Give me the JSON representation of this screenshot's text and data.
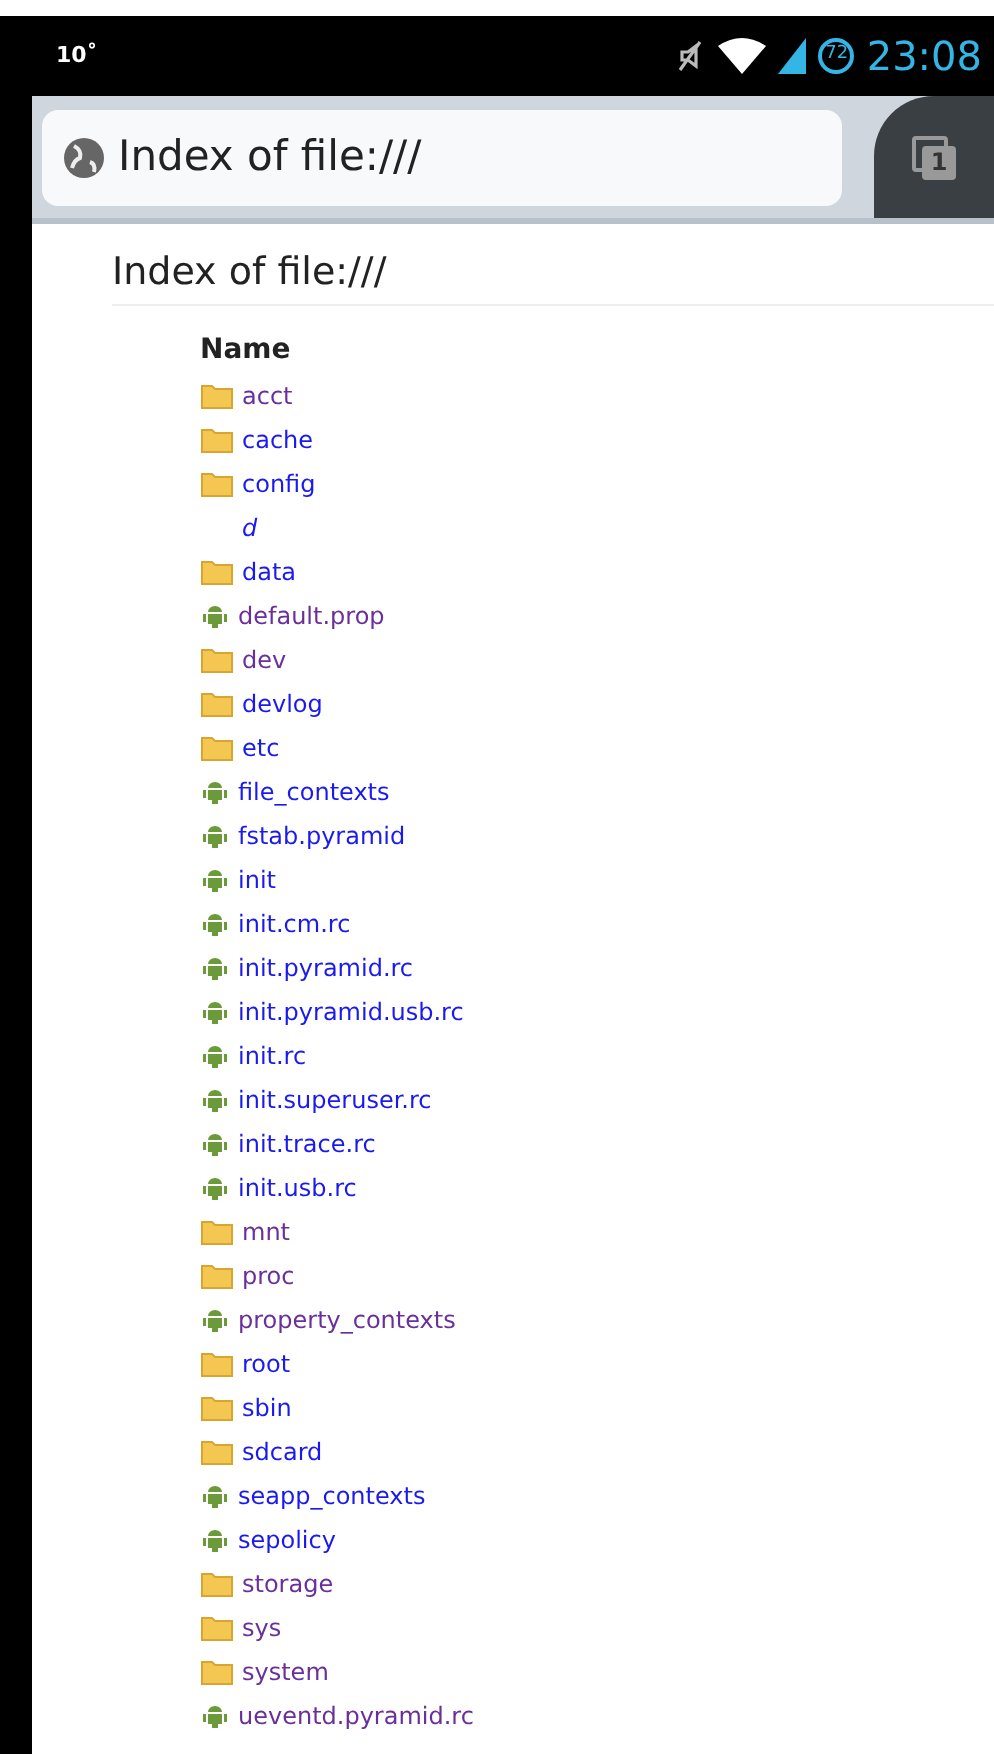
{
  "status_bar": {
    "temperature": "10˚",
    "battery": "72",
    "time": "23:08"
  },
  "toolbar": {
    "url": "Index of file:///",
    "tab_count": "1"
  },
  "page": {
    "heading": "Index of file:///",
    "column": "Name",
    "entries": [
      {
        "name": "acct",
        "kind": "folder",
        "visited": true
      },
      {
        "name": "cache",
        "kind": "folder",
        "visited": false
      },
      {
        "name": "config",
        "kind": "folder",
        "visited": false
      },
      {
        "name": "d",
        "kind": "link",
        "visited": false
      },
      {
        "name": "data",
        "kind": "folder",
        "visited": false
      },
      {
        "name": "default.prop",
        "kind": "file",
        "visited": true
      },
      {
        "name": "dev",
        "kind": "folder",
        "visited": true
      },
      {
        "name": "devlog",
        "kind": "folder",
        "visited": false
      },
      {
        "name": "etc",
        "kind": "folder",
        "visited": false
      },
      {
        "name": "file_contexts",
        "kind": "file",
        "visited": false
      },
      {
        "name": "fstab.pyramid",
        "kind": "file",
        "visited": false
      },
      {
        "name": "init",
        "kind": "file",
        "visited": false
      },
      {
        "name": "init.cm.rc",
        "kind": "file",
        "visited": false
      },
      {
        "name": "init.pyramid.rc",
        "kind": "file",
        "visited": false
      },
      {
        "name": "init.pyramid.usb.rc",
        "kind": "file",
        "visited": false
      },
      {
        "name": "init.rc",
        "kind": "file",
        "visited": false
      },
      {
        "name": "init.superuser.rc",
        "kind": "file",
        "visited": false
      },
      {
        "name": "init.trace.rc",
        "kind": "file",
        "visited": false
      },
      {
        "name": "init.usb.rc",
        "kind": "file",
        "visited": false
      },
      {
        "name": "mnt",
        "kind": "folder",
        "visited": true
      },
      {
        "name": "proc",
        "kind": "folder",
        "visited": true
      },
      {
        "name": "property_contexts",
        "kind": "file",
        "visited": true
      },
      {
        "name": "root",
        "kind": "folder",
        "visited": false
      },
      {
        "name": "sbin",
        "kind": "folder",
        "visited": false
      },
      {
        "name": "sdcard",
        "kind": "folder",
        "visited": false
      },
      {
        "name": "seapp_contexts",
        "kind": "file",
        "visited": false
      },
      {
        "name": "sepolicy",
        "kind": "file",
        "visited": false
      },
      {
        "name": "storage",
        "kind": "folder",
        "visited": true
      },
      {
        "name": "sys",
        "kind": "folder",
        "visited": true
      },
      {
        "name": "system",
        "kind": "folder",
        "visited": true
      },
      {
        "name": "ueventd.pyramid.rc",
        "kind": "file",
        "visited": true
      }
    ]
  }
}
